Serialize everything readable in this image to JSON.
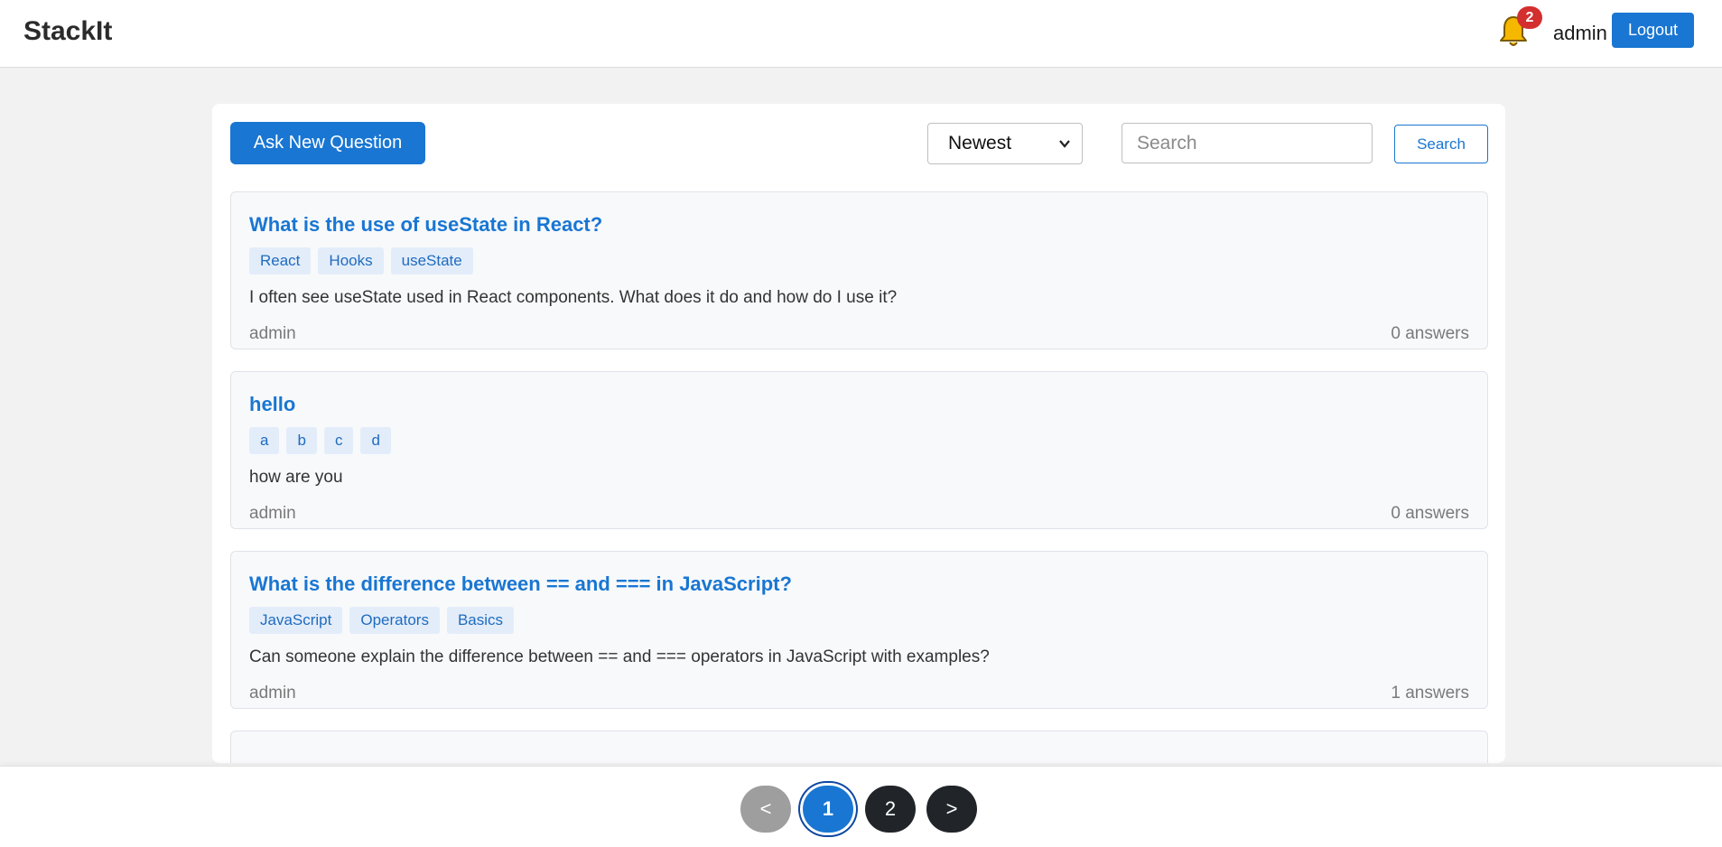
{
  "header": {
    "brand": "StackIt",
    "notification_count": "2",
    "username": "admin",
    "logout_label": "Logout"
  },
  "toolbar": {
    "ask_label": "Ask New Question",
    "sort_selected": "Newest",
    "search_placeholder": "Search",
    "search_label": "Search"
  },
  "questions": [
    {
      "title": "What is the use of useState in React?",
      "tags": [
        "React",
        "Hooks",
        "useState"
      ],
      "body": "I often see useState used in React components. What does it do and how do I use it?",
      "author": "admin",
      "answers": "0 answers"
    },
    {
      "title": "hello",
      "tags": [
        "a",
        "b",
        "c",
        "d"
      ],
      "body": "how are you",
      "author": "admin",
      "answers": "0 answers"
    },
    {
      "title": "What is the difference between == and === in JavaScript?",
      "tags": [
        "JavaScript",
        "Operators",
        "Basics"
      ],
      "body": "Can someone explain the difference between == and === operators in JavaScript with examples?",
      "author": "admin",
      "answers": "1 answers"
    }
  ],
  "pagination": {
    "prev": "<",
    "pages": [
      "1",
      "2"
    ],
    "next": ">"
  },
  "colors": {
    "accent": "#1976d2",
    "badge": "#d32f2f",
    "bell": "#f5b700"
  },
  "icons": {
    "notification": "bell-icon",
    "dropdown": "chevron-down-icon"
  }
}
